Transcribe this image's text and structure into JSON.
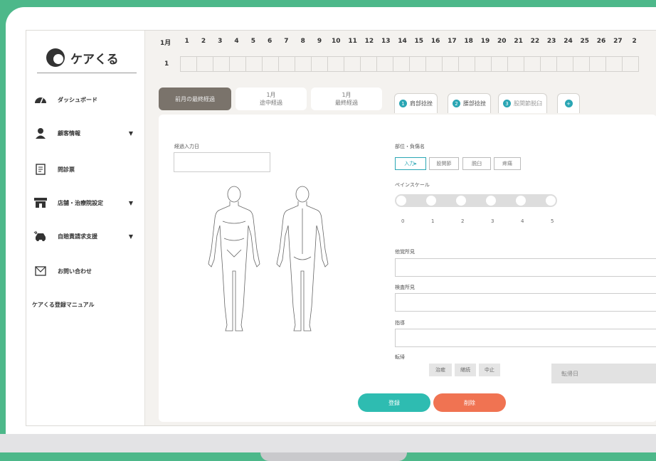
{
  "app": {
    "logo_text": "ケアくる"
  },
  "sidebar": {
    "items": [
      {
        "label": "ダッシュボード",
        "icon": "dashboard-icon",
        "caret": false
      },
      {
        "label": "顧客情報",
        "icon": "person-icon",
        "caret": true
      },
      {
        "label": "問診票",
        "icon": "document-icon",
        "caret": false
      },
      {
        "label": "店舗・治療院設定",
        "icon": "store-icon",
        "caret": true
      },
      {
        "label": "自賠責請求支援",
        "icon": "car-icon",
        "caret": true
      },
      {
        "label": "お問い合わせ",
        "icon": "mail-icon",
        "caret": false
      }
    ],
    "manual": "ケアくる登録マニュアル"
  },
  "calendar": {
    "month": "1月",
    "days": [
      "1",
      "2",
      "3",
      "4",
      "5",
      "6",
      "7",
      "8",
      "9",
      "10",
      "11",
      "12",
      "13",
      "14",
      "15",
      "16",
      "17",
      "18",
      "19",
      "20",
      "21",
      "22",
      "23",
      "24",
      "25",
      "26",
      "27",
      "2"
    ],
    "row_label": "1"
  },
  "top_tabs": [
    {
      "label": "前月の最終経過",
      "active": true
    },
    {
      "label": "1月\n途中経過",
      "active": false
    },
    {
      "label": "1月\n最終経過",
      "active": false
    }
  ],
  "part_tabs": [
    {
      "num": "1",
      "label": "肩部捻挫"
    },
    {
      "num": "2",
      "label": "腰部捻挫"
    },
    {
      "num": "3",
      "label": "股関節脱臼"
    }
  ],
  "add_tab": "+",
  "form": {
    "date_label": "経過入力日",
    "part_label": "部位・負傷名",
    "chips": [
      "入力▸",
      "股関節",
      "脱臼",
      "疼痛"
    ],
    "pain_label": "ペインスケール",
    "pain_nums": [
      "0",
      "1",
      "2",
      "3",
      "4",
      "5"
    ],
    "subjective_label": "他覚所見",
    "exam_label": "検査所見",
    "guidance_label": "指導",
    "outcome_label": "転帰",
    "outcome_options": [
      "治癒",
      "継続",
      "中止"
    ],
    "outcome_date": "転帰日",
    "register": "登録",
    "delete": "削除"
  },
  "colors": {
    "accent": "#2aa6b4",
    "register": "#2ebcb1",
    "delete": "#f07352",
    "frame": "#4db88a"
  }
}
